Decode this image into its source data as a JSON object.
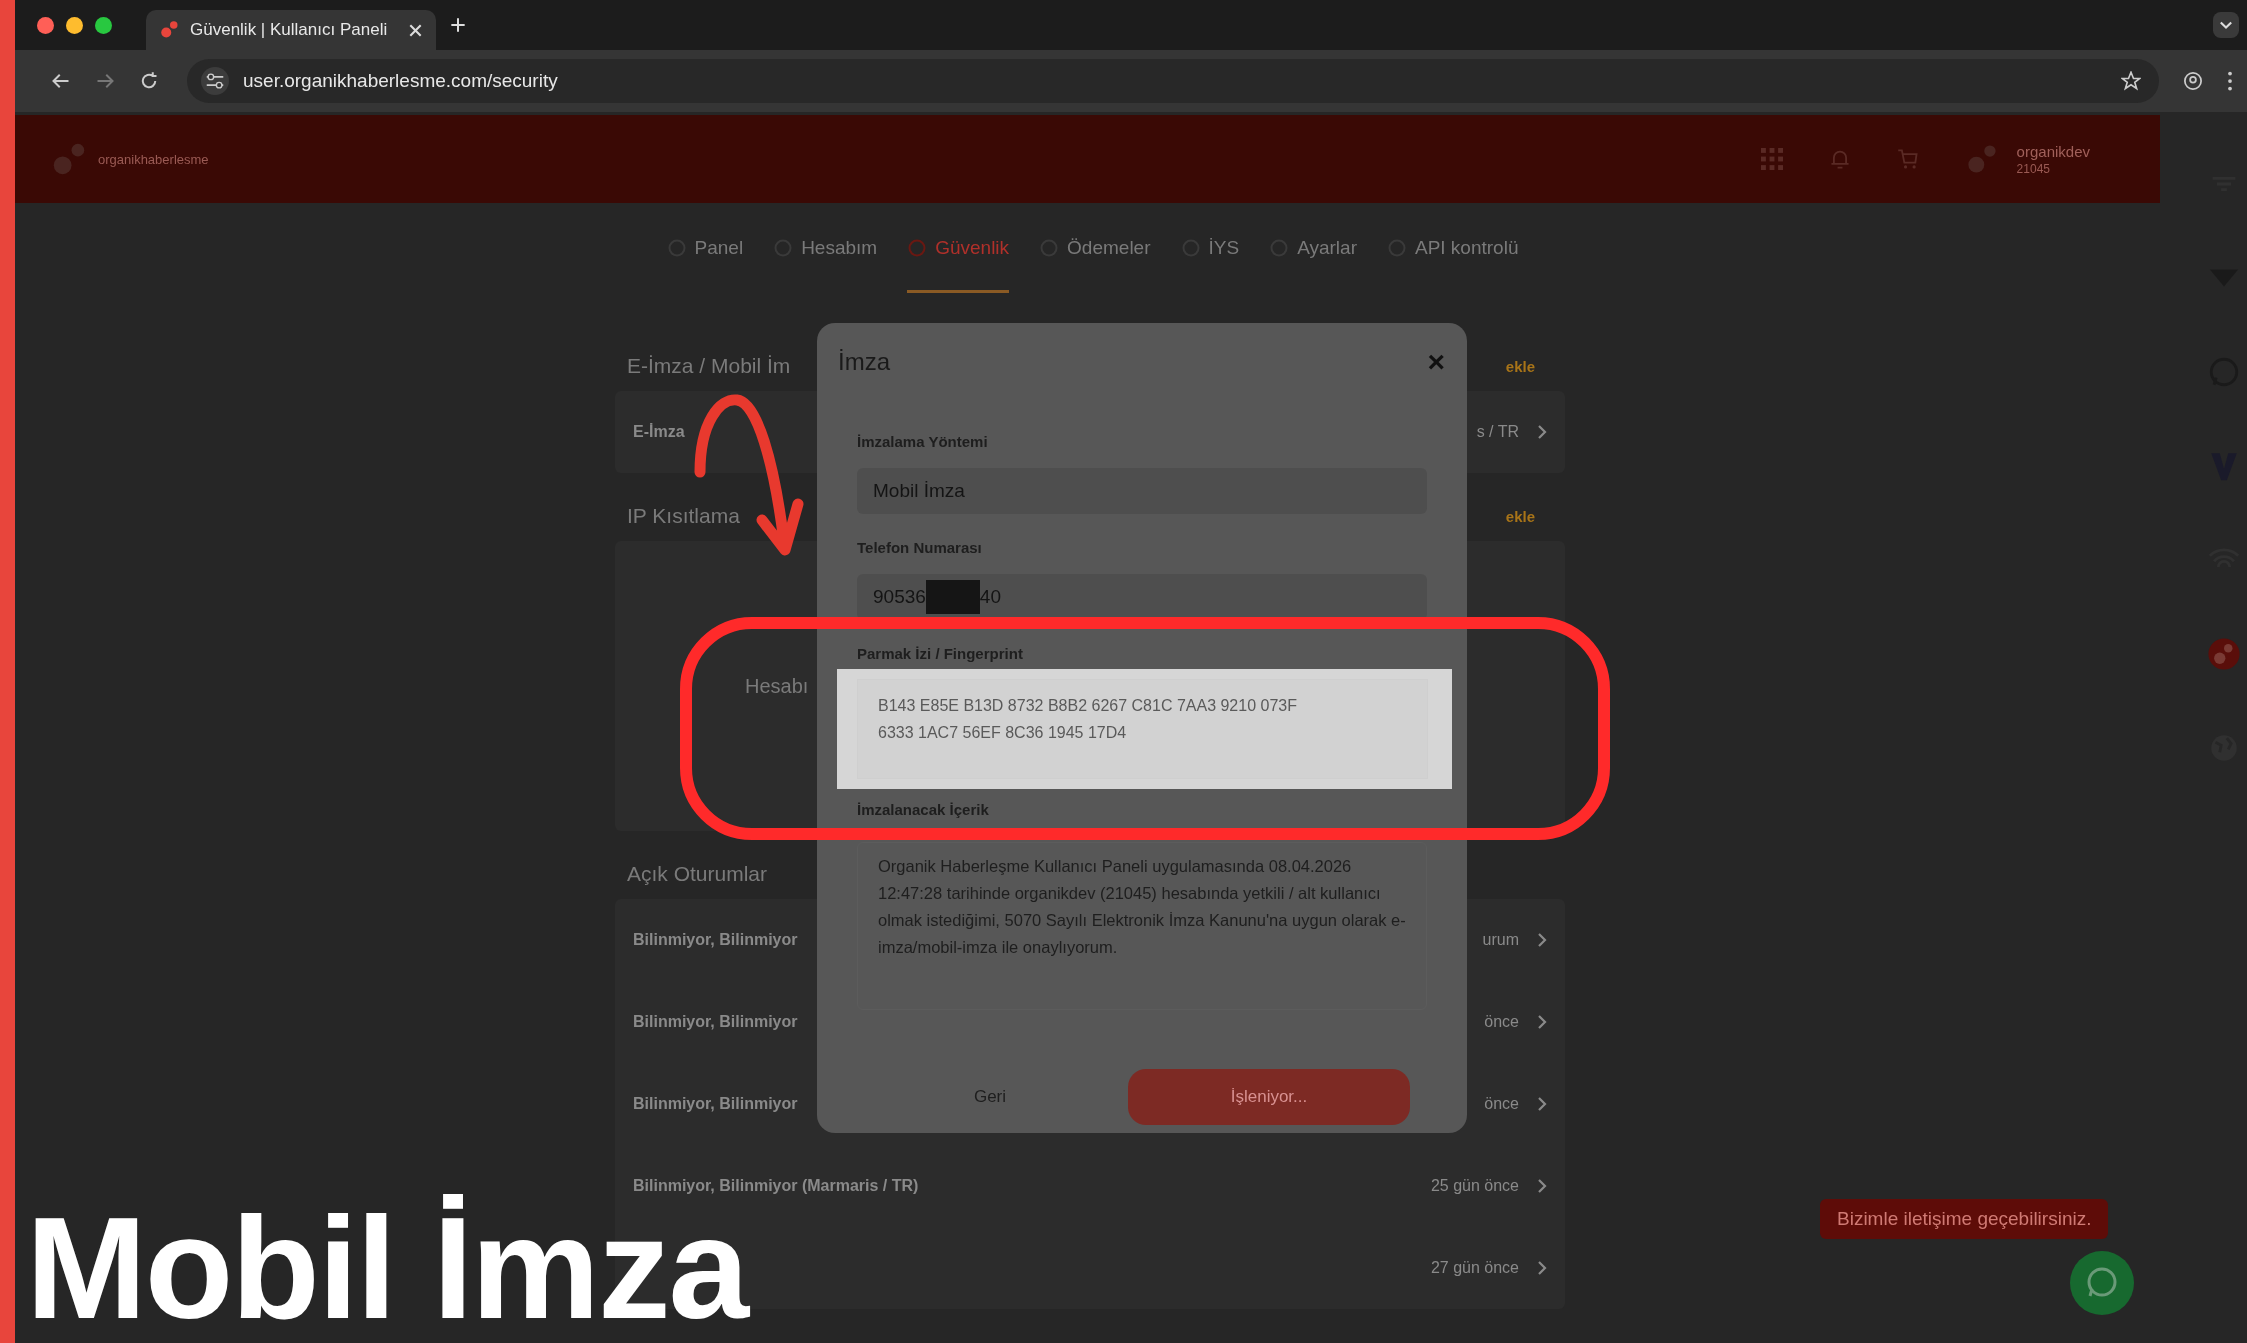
{
  "browser": {
    "tab_title": "Güvenlik | Kullanıcı Paneli",
    "url": "user.organikhaberlesme.com/security"
  },
  "header": {
    "logo_text": "organikhaberlesme",
    "user_name": "organikdev",
    "user_id": "21045"
  },
  "nav": [
    {
      "label": "Panel",
      "selected": false
    },
    {
      "label": "Hesabım",
      "selected": false
    },
    {
      "label": "Güvenlik",
      "selected": true
    },
    {
      "label": "Ödemeler",
      "selected": false
    },
    {
      "label": "İYS",
      "selected": false
    },
    {
      "label": "Ayarlar",
      "selected": false
    },
    {
      "label": "API kontrolü",
      "selected": false
    }
  ],
  "background_sections": [
    {
      "title": "E-İmza / Mobil İm",
      "action": "ekle",
      "rows": [
        {
          "left": "E-İmza",
          "right": "s / TR"
        }
      ]
    },
    {
      "title": "IP Kısıtlama",
      "action": "ekle",
      "note": "Hesabı"
    },
    {
      "title": "Açık Oturumlar",
      "rows": [
        {
          "left": "Bilinmiyor, Bilinmiyor",
          "right": "urum"
        },
        {
          "left": "Bilinmiyor, Bilinmiyor",
          "right": "önce"
        },
        {
          "left": "Bilinmiyor, Bilinmiyor",
          "right": "önce"
        },
        {
          "left": "Bilinmiyor, Bilinmiyor (Marmaris / TR)",
          "right": "25 gün önce"
        },
        {
          "right": "27 gün önce"
        }
      ]
    }
  ],
  "modal": {
    "title": "İmza",
    "close": "×",
    "method_label": "İmzalama Yöntemi",
    "method_value": "Mobil İmza",
    "phone_label": "Telefon Numarası",
    "phone_start": "90536",
    "phone_end": "40",
    "fingerprint_label": "Parmak İzi / Fingerprint",
    "fingerprint": "B143 E85E B13D 8732 B8B2 6267 C81C 7AA3 9210 073F 6333 1AC7 56EF 8C36 1945 17D4",
    "content_label": "İmzalanacak İçerik",
    "content": "Organik Haberleşme Kullanıcı Paneli uygulamasında 08.04.2026 12:47:28 tarihinde organikdev (21045) hesabında yetkili / alt kullanıcı olmak istediğimi, 5070 Sayılı Elektronik İmza Kanunu'na uygun olarak e-imza/mobil-imza ile onaylıyorum.",
    "back_button": "Geri",
    "submit_button": "İşleniyor..."
  },
  "chat_bubble": "Bizimle iletişime geçebilirsiniz.",
  "overlay_caption": "Mobil İmza"
}
